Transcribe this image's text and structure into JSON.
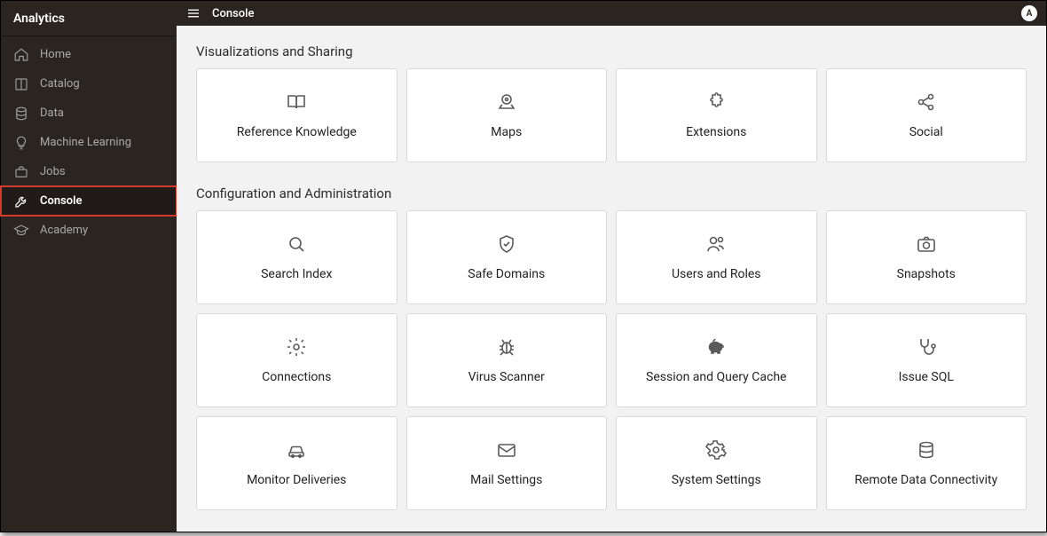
{
  "app_name": "Analytics",
  "topbar": {
    "title": "Console",
    "avatar_letter": "A"
  },
  "sidebar": {
    "items": [
      {
        "id": "home",
        "label": "Home",
        "icon": "home-icon"
      },
      {
        "id": "catalog",
        "label": "Catalog",
        "icon": "book-icon"
      },
      {
        "id": "data",
        "label": "Data",
        "icon": "database-icon"
      },
      {
        "id": "ml",
        "label": "Machine Learning",
        "icon": "lightbulb-icon"
      },
      {
        "id": "jobs",
        "label": "Jobs",
        "icon": "briefcase-icon"
      },
      {
        "id": "console",
        "label": "Console",
        "icon": "wrench-icon",
        "active": true,
        "highlighted": true
      },
      {
        "id": "academy",
        "label": "Academy",
        "icon": "graduation-icon"
      }
    ]
  },
  "sections": [
    {
      "title": "Visualizations and Sharing",
      "cards": [
        {
          "id": "reference-knowledge",
          "label": "Reference Knowledge",
          "icon": "book-open-icon"
        },
        {
          "id": "maps",
          "label": "Maps",
          "icon": "map-pin-icon"
        },
        {
          "id": "extensions",
          "label": "Extensions",
          "icon": "puzzle-icon"
        },
        {
          "id": "social",
          "label": "Social",
          "icon": "share-icon"
        }
      ]
    },
    {
      "title": "Configuration and Administration",
      "cards": [
        {
          "id": "search-index",
          "label": "Search Index",
          "icon": "search-icon"
        },
        {
          "id": "safe-domains",
          "label": "Safe Domains",
          "icon": "shield-icon"
        },
        {
          "id": "users-roles",
          "label": "Users and Roles",
          "icon": "users-icon"
        },
        {
          "id": "snapshots",
          "label": "Snapshots",
          "icon": "camera-icon"
        },
        {
          "id": "connections",
          "label": "Connections",
          "icon": "gear-icon"
        },
        {
          "id": "virus-scanner",
          "label": "Virus Scanner",
          "icon": "bug-icon"
        },
        {
          "id": "session-cache",
          "label": "Session and Query Cache",
          "icon": "piggy-icon",
          "solid": true
        },
        {
          "id": "issue-sql",
          "label": "Issue SQL",
          "icon": "stethoscope-icon"
        },
        {
          "id": "monitor-deliveries",
          "label": "Monitor Deliveries",
          "icon": "car-icon"
        },
        {
          "id": "mail-settings",
          "label": "Mail Settings",
          "icon": "mail-icon"
        },
        {
          "id": "system-settings",
          "label": "System Settings",
          "icon": "cog-icon"
        },
        {
          "id": "remote-data",
          "label": "Remote Data Connectivity",
          "icon": "db-stack-icon"
        }
      ]
    }
  ]
}
